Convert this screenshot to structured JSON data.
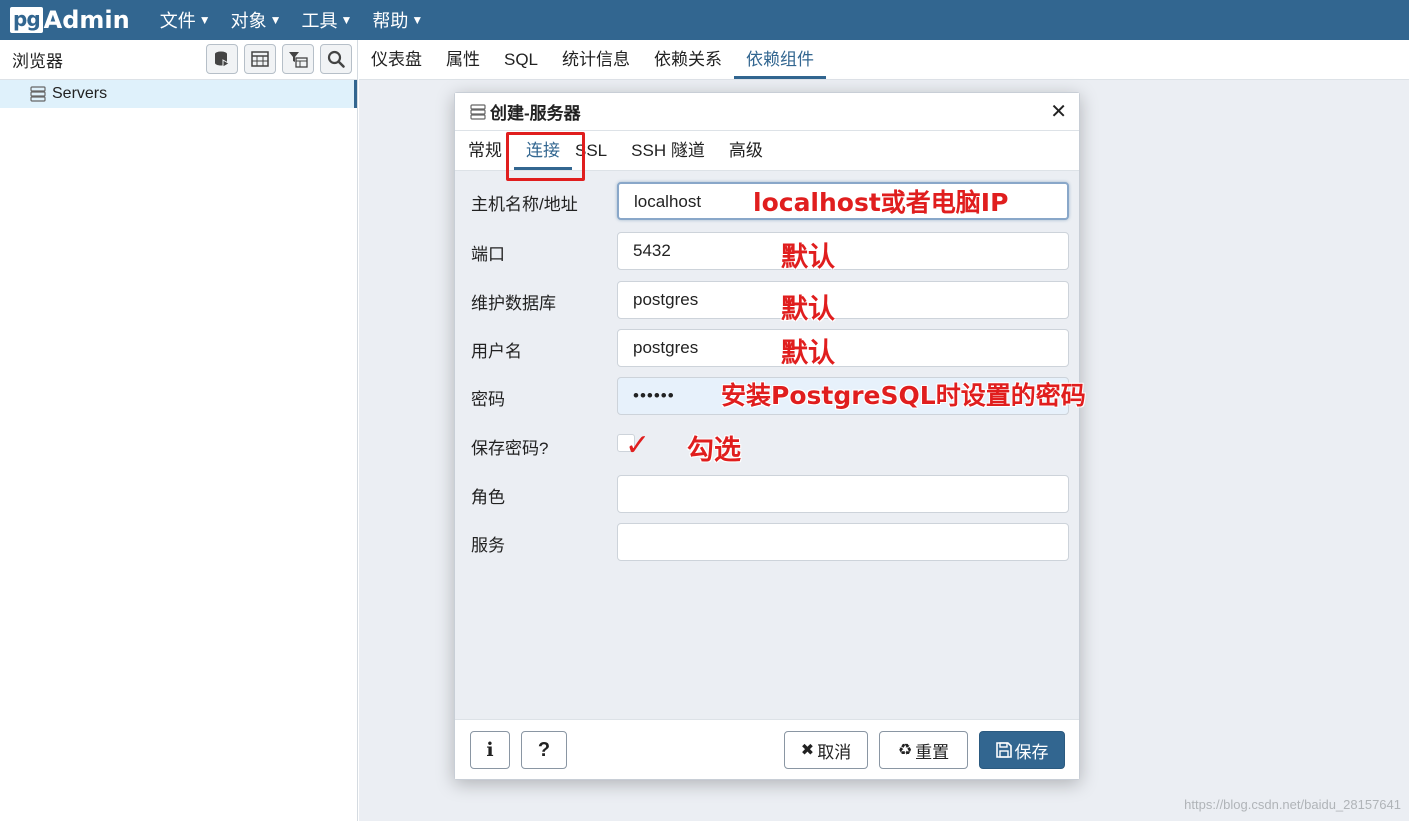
{
  "app": {
    "brand_pg": "pg",
    "brand_admin": "Admin",
    "menu": [
      {
        "label": "文件"
      },
      {
        "label": "对象"
      },
      {
        "label": "工具"
      },
      {
        "label": "帮助"
      }
    ]
  },
  "browser": {
    "title": "浏览器",
    "tools": [
      "database-icon",
      "table-icon",
      "filter-table-icon",
      "search-icon"
    ],
    "tree": [
      {
        "label": "Servers",
        "icon": "server-group-icon"
      }
    ]
  },
  "main_tabs": [
    {
      "label": "仪表盘"
    },
    {
      "label": "属性"
    },
    {
      "label": "SQL"
    },
    {
      "label": "统计信息"
    },
    {
      "label": "依赖关系"
    },
    {
      "label": "依赖组件",
      "active": true
    }
  ],
  "dialog": {
    "title": "创建-服务器",
    "tabs": [
      {
        "label": "常规"
      },
      {
        "label": "连接",
        "active": true
      },
      {
        "label": "SSL"
      },
      {
        "label": "SSH 隧道"
      },
      {
        "label": "高级"
      }
    ],
    "fields": {
      "host": {
        "label": "主机名称/地址",
        "value": "localhost"
      },
      "port": {
        "label": "端口",
        "value": "5432"
      },
      "maint_db": {
        "label": "维护数据库",
        "value": "postgres"
      },
      "username": {
        "label": "用户名",
        "value": "postgres"
      },
      "password": {
        "label": "密码",
        "value": "••••••"
      },
      "save_password": {
        "label": "保存密码?",
        "checked": false
      },
      "role": {
        "label": "角色",
        "value": ""
      },
      "service": {
        "label": "服务",
        "value": ""
      }
    },
    "footer": {
      "info_label": "i",
      "help_label": "?",
      "cancel_label": "取消",
      "reset_label": "重置",
      "save_label": "保存"
    }
  },
  "annotations": {
    "host_note": "localhost或者电脑IP",
    "port_note": "默认",
    "db_note": "默认",
    "user_note": "默认",
    "password_note": "安装PostgreSQL时设置的密码",
    "checkbox_note": "勾选",
    "checkmark": "✓",
    "color": "#e01e1e"
  },
  "watermark": "https://blog.csdn.net/baidu_28157641",
  "colors": {
    "primary": "#326690",
    "panel_bg": "#ebeef3",
    "selected_row": "#dff1fb"
  }
}
